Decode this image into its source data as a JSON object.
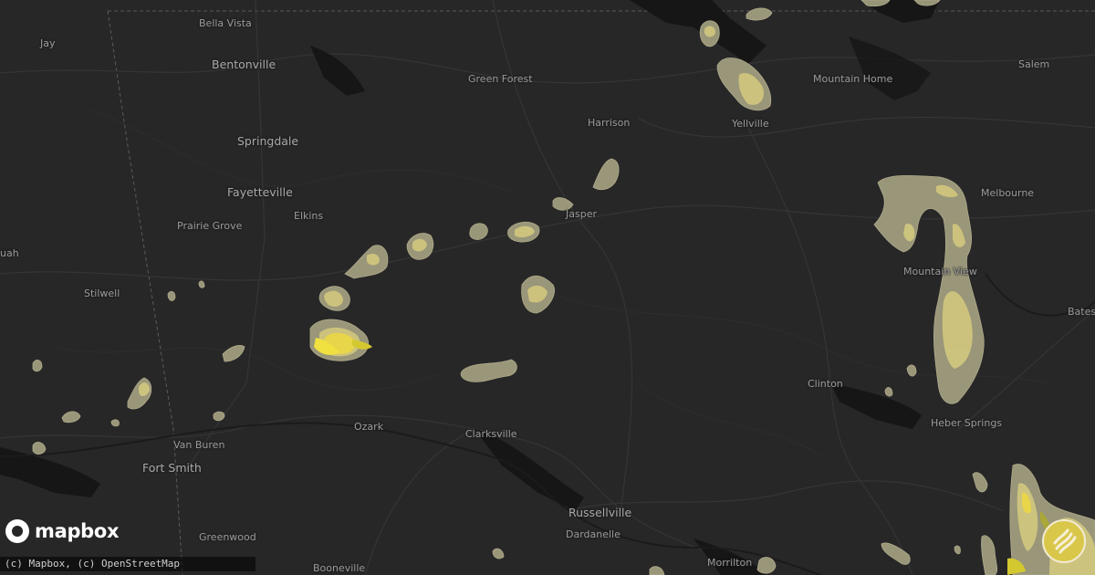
{
  "map": {
    "attribution": "(c) Mapbox, (c) OpenStreetMap",
    "logo_text": "mapbox",
    "colors": {
      "background": "#272727",
      "roads": "#3a3a3a",
      "water": "#161616",
      "hail_light": "#a3a081",
      "hail_mid": "#cfc57e",
      "hail_heavy": "#e8d54a"
    },
    "cities": [
      {
        "name": "Bella Vista"
      },
      {
        "name": "Jay"
      },
      {
        "name": "Bentonville"
      },
      {
        "name": "Springdale"
      },
      {
        "name": "Fayetteville"
      },
      {
        "name": "Elkins"
      },
      {
        "name": "Prairie Grove"
      },
      {
        "name": "Stilwell"
      },
      {
        "name": "uah"
      },
      {
        "name": "Green Forest"
      },
      {
        "name": "Harrison"
      },
      {
        "name": "Jasper"
      },
      {
        "name": "Yellville"
      },
      {
        "name": "Mountain Home"
      },
      {
        "name": "Salem"
      },
      {
        "name": "Melbourne"
      },
      {
        "name": "Mountain View"
      },
      {
        "name": "Bates"
      },
      {
        "name": "Clinton"
      },
      {
        "name": "Heber Springs"
      },
      {
        "name": "Van Buren"
      },
      {
        "name": "Fort Smith"
      },
      {
        "name": "Ozark"
      },
      {
        "name": "Clarksville"
      },
      {
        "name": "Russellville"
      },
      {
        "name": "Dardanelle"
      },
      {
        "name": "Greenwood"
      },
      {
        "name": "Booneville"
      },
      {
        "name": "Morrilton"
      }
    ],
    "badge_icon": "hail-storm-icon"
  }
}
